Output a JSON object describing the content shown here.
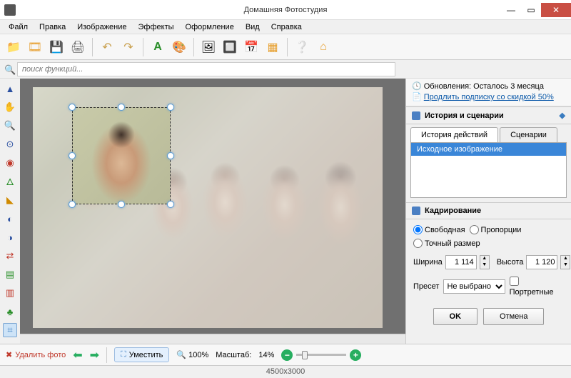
{
  "window": {
    "title": "Домашняя Фотостудия"
  },
  "menu": {
    "items": [
      "Файл",
      "Правка",
      "Изображение",
      "Эффекты",
      "Оформление",
      "Вид",
      "Справка"
    ]
  },
  "search": {
    "placeholder": "поиск функций..."
  },
  "update_notice": {
    "line1": "Обновления: Осталось  3 месяца",
    "line2": "Продлить подписку со скидкой 50%"
  },
  "panels": {
    "history": {
      "title": "История и сценарии",
      "tabs": [
        "История действий",
        "Сценарии"
      ],
      "active_tab": 0,
      "items": [
        "Исходное изображение"
      ]
    },
    "crop": {
      "title": "Кадрирование",
      "mode_options": [
        "Свободная",
        "Пропорции",
        "Точный размер"
      ],
      "mode_selected": 0,
      "width_label": "Ширина",
      "height_label": "Высота",
      "width_value": "1 114",
      "height_value": "1 120",
      "preset_label": "Пресет",
      "preset_value": "Не выбрано",
      "portrait_label": "Портретные",
      "ok_label": "OK",
      "cancel_label": "Отмена"
    }
  },
  "bottombar": {
    "delete_label": "Удалить фото",
    "fit_label": "Уместить",
    "hundred_label": "100%",
    "scale_label": "Масштаб:",
    "scale_value": "14%"
  },
  "status": {
    "resolution": "4500x3000"
  },
  "left_tools": [
    "cursor",
    "hand",
    "zoom",
    "clone",
    "red-eye",
    "lasso",
    "gradient",
    "contrast",
    "brightness",
    "crop2",
    "levels",
    "layers",
    "retouch",
    "crop-active"
  ]
}
